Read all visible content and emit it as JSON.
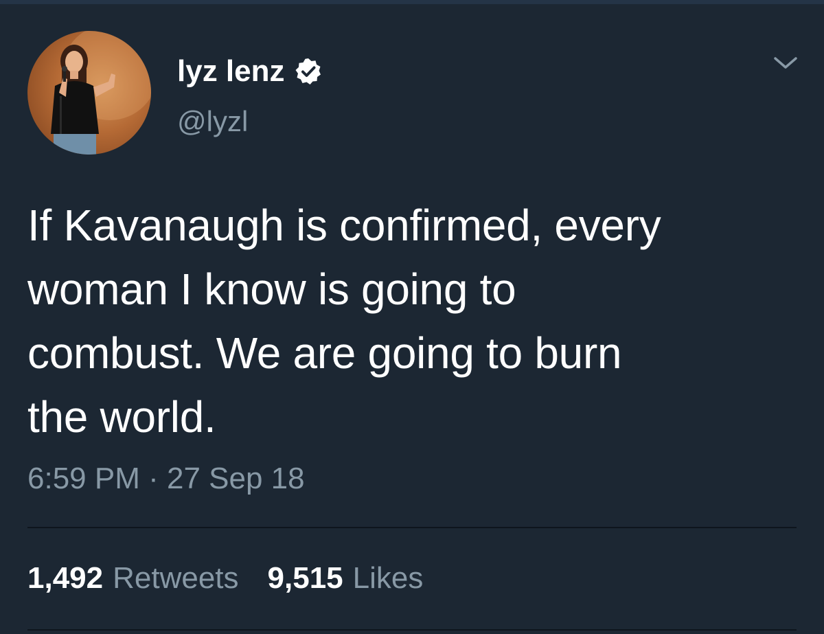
{
  "tweet": {
    "author": {
      "name": "lyz lenz",
      "handle": "@lyzl",
      "verified": true,
      "avatar_icon": "person-at-microphone-avatar"
    },
    "text_lines": [
      "If Kavanaugh is confirmed, every",
      "woman I know is going to",
      "combust. We are going to burn",
      "the world."
    ],
    "time": "6:59 PM",
    "separator": "·",
    "date": "27 Sep 18",
    "stats": {
      "retweets_count": "1,492",
      "retweets_label": "Retweets",
      "likes_count": "9,515",
      "likes_label": "Likes"
    }
  },
  "colors": {
    "background": "#1c2733",
    "primary_text": "#ffffff",
    "secondary_text": "#8899a6",
    "divider": "#0e151d"
  },
  "icons": {
    "verified": "verified-badge-icon",
    "menu": "chevron-down-icon"
  }
}
